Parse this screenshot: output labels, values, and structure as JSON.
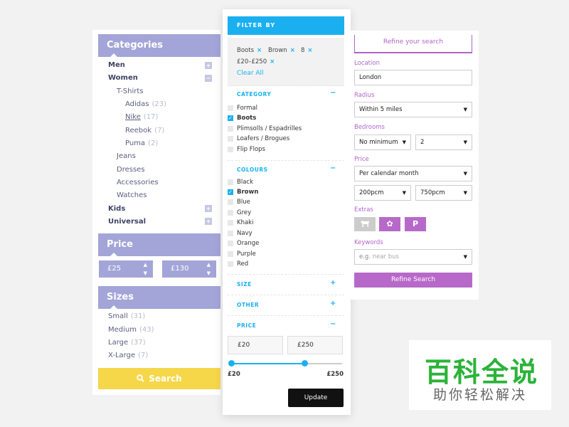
{
  "left": {
    "categories_header": "Categories",
    "categories": [
      {
        "label": "Men",
        "toggle": "+"
      },
      {
        "label": "Women",
        "toggle": "−"
      },
      {
        "label": "T-Shirts"
      },
      {
        "label": "Adidas",
        "count": "(23)"
      },
      {
        "label": "Nike",
        "count": "(17)"
      },
      {
        "label": "Reebok",
        "count": "(7)"
      },
      {
        "label": "Puma",
        "count": "(2)"
      },
      {
        "label": "Jeans"
      },
      {
        "label": "Dresses"
      },
      {
        "label": "Accessories"
      },
      {
        "label": "Watches"
      },
      {
        "label": "Kids",
        "toggle": "+"
      },
      {
        "label": "Universal",
        "toggle": "+"
      }
    ],
    "price_header": "Price",
    "price_min": "£25",
    "price_max": "£130",
    "sizes_header": "Sizes",
    "sizes": [
      {
        "label": "Small",
        "count": "(31)"
      },
      {
        "label": "Medium",
        "count": "(43)"
      },
      {
        "label": "Large",
        "count": "(37)"
      },
      {
        "label": "X-Large",
        "count": "(7)"
      }
    ],
    "search_label": "Search"
  },
  "middle": {
    "header": "FILTER BY",
    "chips": [
      "Boots",
      "Brown",
      "8",
      "£20–£250"
    ],
    "chip_remove": "×",
    "clear_all": "Clear All",
    "category_title": "CATEGORY",
    "category_toggle": "−",
    "category_options": [
      {
        "label": "Formal",
        "checked": false
      },
      {
        "label": "Boots",
        "checked": true
      },
      {
        "label": "Plimsolls / Espadrilles",
        "checked": false
      },
      {
        "label": "Loafers / Brogues",
        "checked": false
      },
      {
        "label": "Flip Flops",
        "checked": false
      }
    ],
    "colours_title": "COLOURS",
    "colours_toggle": "−",
    "colour_options": [
      {
        "label": "Black",
        "checked": false
      },
      {
        "label": "Brown",
        "checked": true
      },
      {
        "label": "Blue",
        "checked": false
      },
      {
        "label": "Grey",
        "checked": false
      },
      {
        "label": "Khaki",
        "checked": false
      },
      {
        "label": "Navy",
        "checked": false
      },
      {
        "label": "Orange",
        "checked": false
      },
      {
        "label": "Purple",
        "checked": false
      },
      {
        "label": "Red",
        "checked": false
      }
    ],
    "size_title": "SIZE",
    "size_toggle": "+",
    "other_title": "OTHER",
    "other_toggle": "+",
    "price_title": "PRICE",
    "price_toggle": "−",
    "price_min": "£20",
    "price_max": "£250",
    "slider_min_label": "£20",
    "slider_max_label": "£250",
    "update_label": "Update"
  },
  "right": {
    "title": "Refine your search",
    "location_label": "Location",
    "location_value": "London",
    "radius_label": "Radius",
    "radius_value": "Within 5 miles",
    "bedrooms_label": "Bedrooms",
    "bedrooms_min": "No minimum",
    "bedrooms_max": "2",
    "price_label": "Price",
    "price_period": "Per calendar month",
    "price_min": "200pcm",
    "price_max": "750pcm",
    "extras_label": "Extras",
    "extras": [
      {
        "icon": "dog-icon",
        "color": "#cccccc"
      },
      {
        "icon": "flower-icon",
        "color": "#b769c9",
        "glyph": "✿"
      },
      {
        "icon": "parking-icon",
        "color": "#b769c9",
        "glyph": "P"
      }
    ],
    "keywords_label": "Keywords",
    "keywords_placeholder_prefix": "e.g.",
    "keywords_placeholder": "near bus",
    "refine_button": "Refine Search"
  },
  "watermark": {
    "title": "百科全说",
    "subtitle": "助你轻松解决"
  },
  "colors": {
    "left_accent": "#a3a5d8",
    "search_yellow": "#f6d74a",
    "filter_blue": "#1ab0f0",
    "refine_purple": "#b769c9",
    "watermark_green": "#2bb339"
  }
}
